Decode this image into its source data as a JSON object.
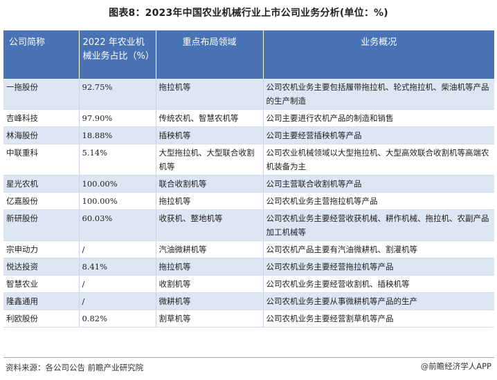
{
  "title": "图表8：2023年中国农业机械行业上市公司业务分析(单位：%)",
  "table": {
    "headers": [
      "公司简称",
      "2022 年农业机械业务占比（%）",
      "重点布局领域",
      "业务概况"
    ],
    "rows": [
      {
        "name": "一拖股份",
        "share": "92.75%",
        "field": "拖拉机等",
        "overview": "公司农机业务主要包括履带拖拉机、轮式拖拉机、柴油机等产品的生产制造"
      },
      {
        "name": "吉峰科技",
        "share": "97.90%",
        "field": "传统农机、智慧农机等",
        "overview": "公司主要进行农机产品的制造和销售"
      },
      {
        "name": "林海股份",
        "share": "18.88%",
        "field": "插秧机等",
        "overview": "公司主要经营插秧机等产品"
      },
      {
        "name": "中联重科",
        "share": "5.14%",
        "field": "大型拖拉机、大型联合收割机等",
        "overview": "公司农业机械领域以大型拖拉机、大型高效联合收割机等高端农机装备为主"
      },
      {
        "name": "星光农机",
        "share": "100.00%",
        "field": "联合收割机等",
        "overview": "公司主营联合收割机等产品"
      },
      {
        "name": "亿嘉股份",
        "share": "100.00%",
        "field": "拖拉机等",
        "overview": "公司农机业务主营拖拉机等产品"
      },
      {
        "name": "新研股份",
        "share": "60.03%",
        "field": "收获机、整地机等",
        "overview": "公司农机业务主要经营收获机械、耕作机械、拖拉机、农副产品加工机械等"
      },
      {
        "name": "宗申动力",
        "share": "/",
        "field": "汽油微耕机等",
        "overview": "公司农机产品主要有汽油微耕机、割灌机等"
      },
      {
        "name": "悦达投资",
        "share": "8.41%",
        "field": "拖拉机等",
        "overview": "公司农机业务主要经营拖拉机等产品"
      },
      {
        "name": "智慧农业",
        "share": "/",
        "field": "收割机等",
        "overview": "公司农机业务主要经营收割机、插秧机等"
      },
      {
        "name": "隆鑫通用",
        "share": "/",
        "field": "微耕机等",
        "overview": "公司农机业务主要从事微耕机等产品的生产"
      },
      {
        "name": "利欧股份",
        "share": "0.82%",
        "field": "割草机等",
        "overview": "公司农机业务主要经营割草机等产品"
      }
    ]
  },
  "footer": {
    "source": "资料来源：各公司公告 前瞻产业研究院",
    "brand": "@前瞻经济学人APP"
  },
  "colors": {
    "header_bg": "#4a73b6",
    "odd_row_bg": "#dde6f3",
    "even_row_bg": "#ffffff"
  }
}
